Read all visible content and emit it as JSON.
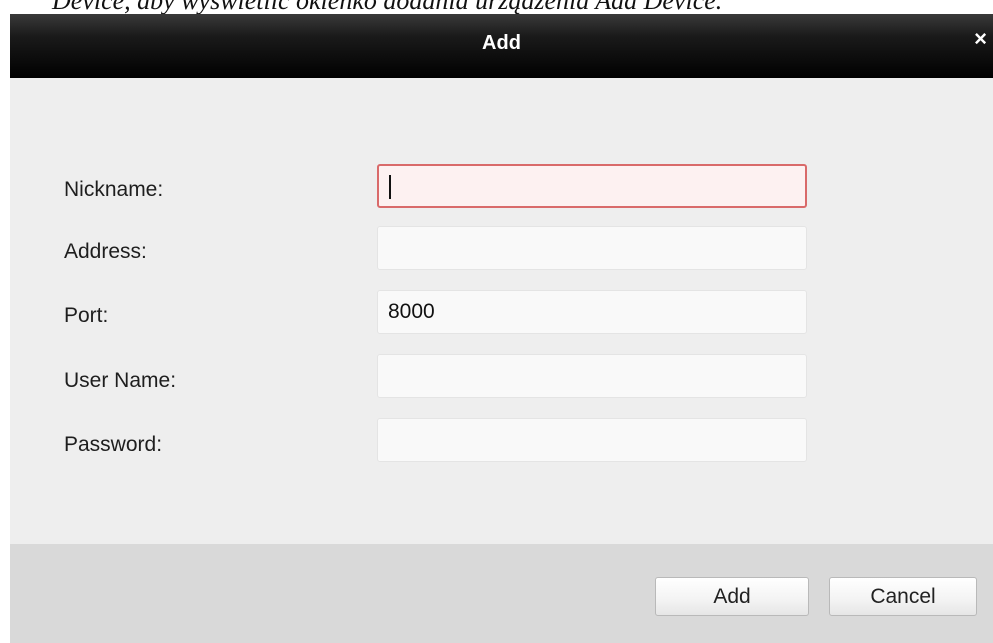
{
  "caption": {
    "text": "Device, aby wyświetlić okienko dodania urządzenia Add Device."
  },
  "dialog": {
    "title": "Add",
    "close_glyph": "×",
    "close_icon": "close-icon"
  },
  "form": {
    "fields": [
      {
        "label": "Nickname:",
        "value": "",
        "focused": true
      },
      {
        "label": "Address:",
        "value": ""
      },
      {
        "label": "Port:",
        "value": "8000"
      },
      {
        "label": "User Name:",
        "value": ""
      },
      {
        "label": "Password:",
        "value": ""
      }
    ]
  },
  "buttons": {
    "add": "Add",
    "cancel": "Cancel"
  },
  "colors": {
    "titlebar": "#000000",
    "focus_border": "#d96a6a",
    "panel": "#eeeeee",
    "footer": "#d9d9d9"
  }
}
